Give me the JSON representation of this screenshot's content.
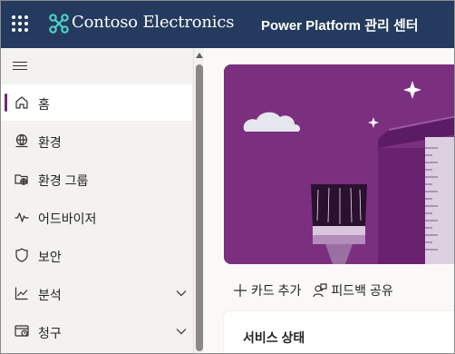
{
  "header": {
    "waffle_icon": "waffle-icon",
    "logo_icon": "contoso-logo-icon",
    "brand": "Contoso Electronics",
    "product": "Power Platform 관리 센터",
    "background": "#243a5e"
  },
  "sidebar": {
    "menu_icon": "hamburger-icon",
    "accent": "#742774",
    "items": [
      {
        "label": "홈",
        "icon": "home-icon",
        "selected": true
      },
      {
        "label": "환경",
        "icon": "globe-icon"
      },
      {
        "label": "환경 그룹",
        "icon": "folder-globe-icon"
      },
      {
        "label": "어드바이저",
        "icon": "pulse-icon"
      },
      {
        "label": "보안",
        "icon": "shield-icon"
      },
      {
        "label": "분석",
        "icon": "chart-icon",
        "expandable": true
      },
      {
        "label": "청구",
        "icon": "billing-icon",
        "expandable": true
      }
    ]
  },
  "main": {
    "hero_color": "#7b2f7f",
    "commands": {
      "add_card": "카드 추가",
      "feedback": "피드백 공유"
    },
    "card": {
      "title": "서비스 상태"
    }
  }
}
